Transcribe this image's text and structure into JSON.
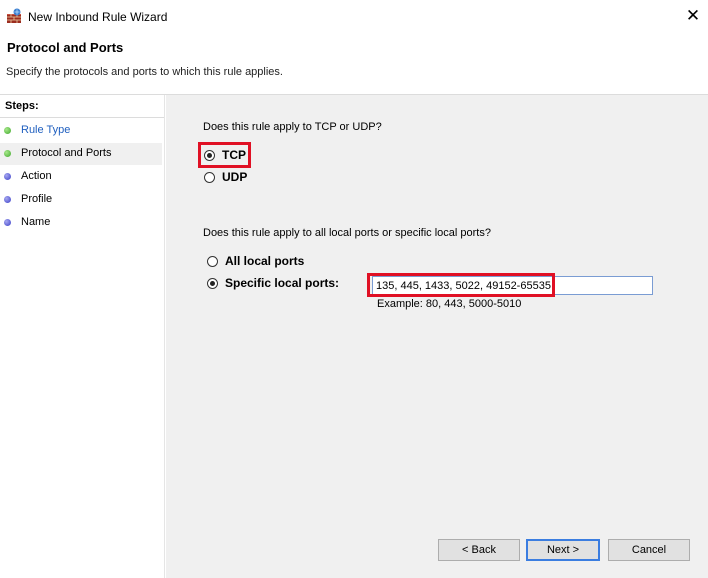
{
  "window": {
    "title": "New Inbound Rule Wizard",
    "close_glyph": "✕"
  },
  "header": {
    "title": "Protocol and Ports",
    "subtitle": "Specify the protocols and ports to which this rule applies."
  },
  "sidebar": {
    "heading": "Steps:",
    "items": [
      {
        "label": "Rule Type",
        "status": "done"
      },
      {
        "label": "Protocol and Ports",
        "status": "current"
      },
      {
        "label": "Action",
        "status": "pending"
      },
      {
        "label": "Profile",
        "status": "pending"
      },
      {
        "label": "Name",
        "status": "pending"
      }
    ]
  },
  "protocol": {
    "question": "Does this rule apply to TCP or UDP?",
    "options": [
      {
        "label": "TCP",
        "selected": true
      },
      {
        "label": "UDP",
        "selected": false
      }
    ]
  },
  "ports": {
    "question": "Does this rule apply to all local ports or specific local ports?",
    "options": [
      {
        "label": "All local ports",
        "selected": false
      },
      {
        "label": "Specific local ports:",
        "selected": true
      }
    ],
    "value": "135, 445, 1433, 5022, 49152-65535",
    "example": "Example: 80, 443, 5000-5010"
  },
  "buttons": {
    "back": "< Back",
    "next": "Next >",
    "cancel": "Cancel"
  },
  "colors": {
    "highlight": "#e01024",
    "link": "#1f5fbf",
    "panel": "#f0f0f0"
  }
}
